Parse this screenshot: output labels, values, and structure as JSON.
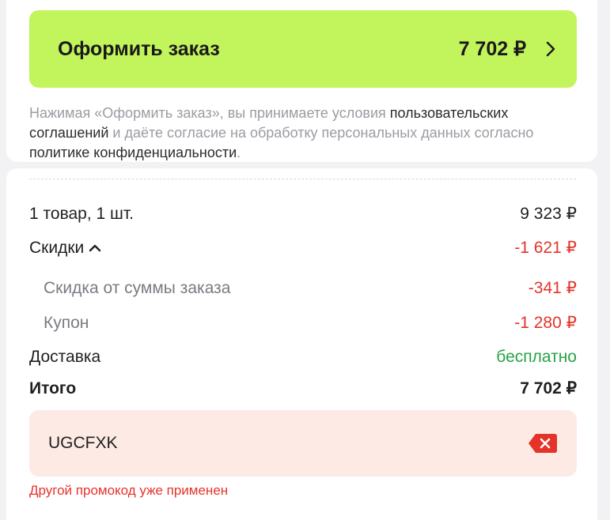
{
  "checkout": {
    "button_label": "Оформить заказ",
    "total": "7 702 ₽",
    "accent_color": "#c2f45b"
  },
  "terms": {
    "part1": "Нажимая «Оформить заказ», вы принимаете условия ",
    "link1": "пользовательских соглашений",
    "part2": " и даёте согласие на обработку персональных данных согласно ",
    "link2": "политике конфиденциальности",
    "part3": "."
  },
  "summary": {
    "items_label": "1 товар, 1 шт.",
    "items_value": "9 323 ₽",
    "discounts_label": "Скидки",
    "discounts_value": "-1 621 ₽",
    "discount_rows": [
      {
        "label": "Скидка от суммы заказа",
        "value": "-341 ₽"
      },
      {
        "label": "Купон",
        "value": "-1 280 ₽"
      }
    ],
    "delivery_label": "Доставка",
    "delivery_value": "бесплатно",
    "total_label": "Итого",
    "total_value": "7 702 ₽"
  },
  "promo": {
    "value": "UGCFXK",
    "error": "Другой промокод уже применен",
    "error_color": "#e5332a"
  },
  "icons": {
    "checkout": "chevron-right-icon",
    "discounts": "chevron-up-icon",
    "clear": "backspace-clear-icon"
  }
}
